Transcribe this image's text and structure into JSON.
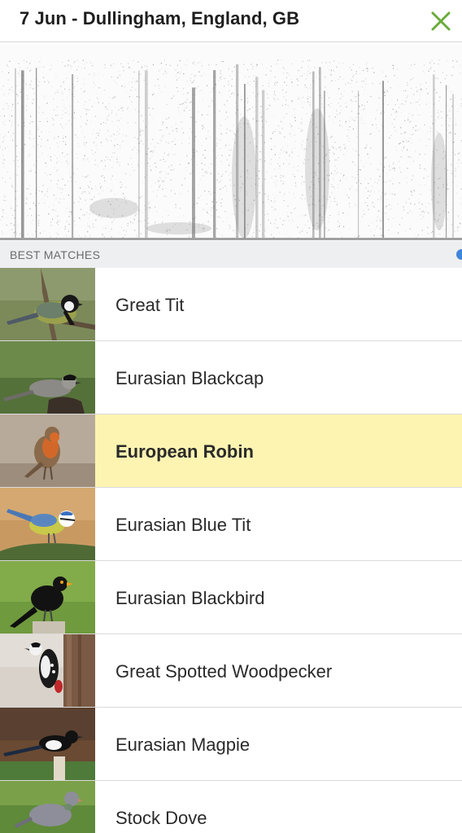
{
  "header": {
    "title": "7 Jun - Dullingham, England, GB",
    "close_icon": "close-icon",
    "accent_color": "#6aab3a"
  },
  "spectrogram": {
    "icon": "spectrogram-image"
  },
  "section": {
    "label": "BEST MATCHES"
  },
  "matches": [
    {
      "name": "Great Tit",
      "selected": false,
      "thumb": "great-tit-photo"
    },
    {
      "name": "Eurasian Blackcap",
      "selected": false,
      "thumb": "blackcap-photo"
    },
    {
      "name": "European Robin",
      "selected": true,
      "thumb": "robin-photo"
    },
    {
      "name": "Eurasian Blue Tit",
      "selected": false,
      "thumb": "blue-tit-photo"
    },
    {
      "name": "Eurasian Blackbird",
      "selected": false,
      "thumb": "blackbird-photo"
    },
    {
      "name": "Great Spotted Woodpecker",
      "selected": false,
      "thumb": "woodpecker-photo"
    },
    {
      "name": "Eurasian Magpie",
      "selected": false,
      "thumb": "magpie-photo"
    },
    {
      "name": "Stock Dove",
      "selected": false,
      "thumb": "stock-dove-photo"
    }
  ],
  "colors": {
    "selected_row": "#fdf4b2",
    "section_bar": "#eeeff0",
    "scroll_indicator": "#3f85d9"
  }
}
